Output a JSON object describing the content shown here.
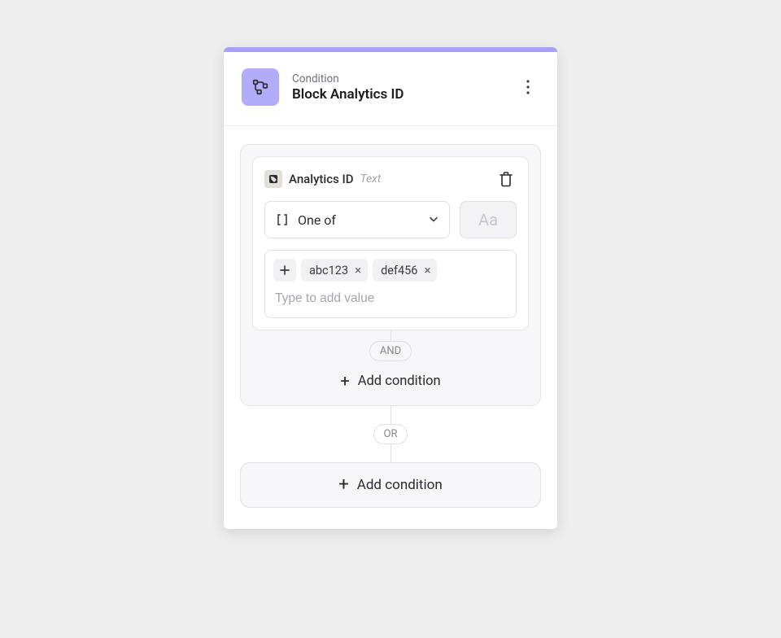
{
  "header": {
    "eyebrow": "Condition",
    "title": "Block Analytics ID"
  },
  "condition": {
    "field_name": "Analytics ID",
    "field_type": "Text",
    "operator": "One of",
    "case_hint": "Aa",
    "values": [
      "abc123",
      "def456"
    ],
    "value_placeholder": "Type to add value"
  },
  "connectors": {
    "and": "AND",
    "or": "OR"
  },
  "actions": {
    "add_condition": "Add condition"
  }
}
